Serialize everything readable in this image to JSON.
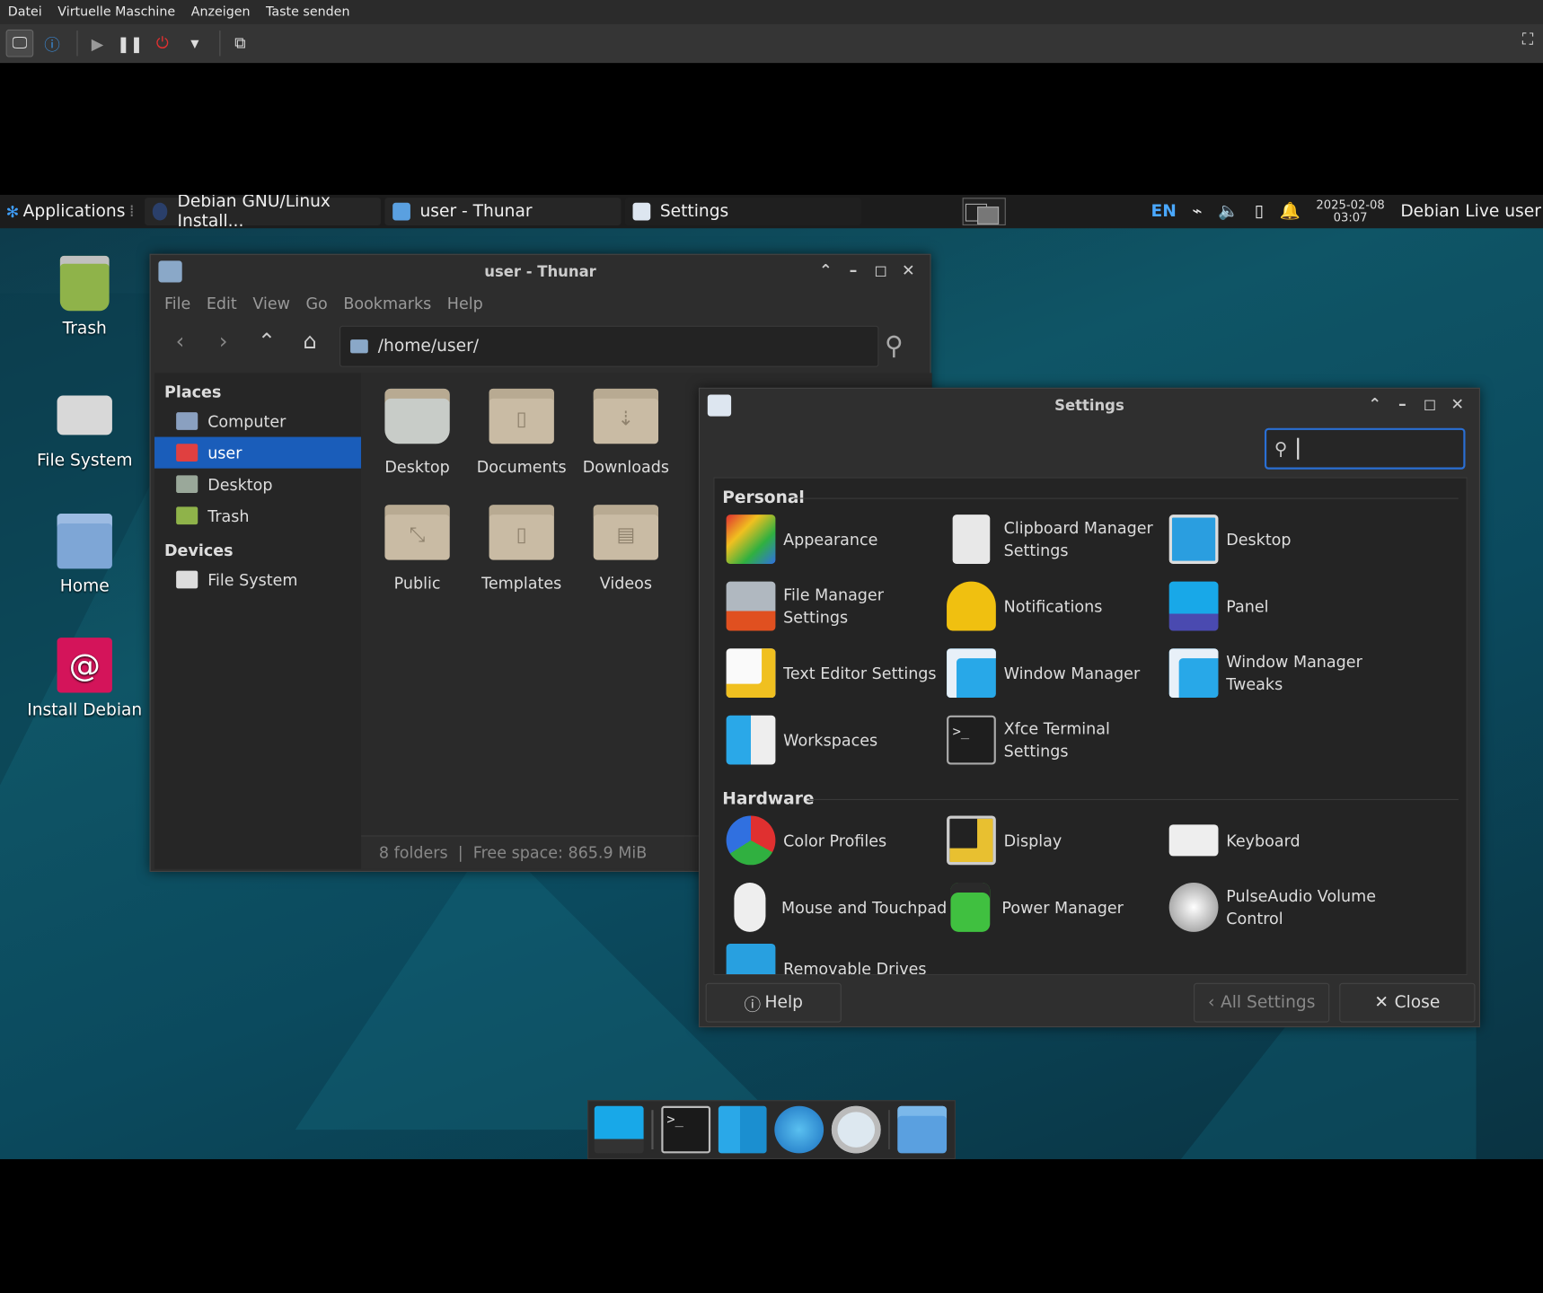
{
  "host": {
    "menu": [
      "Datei",
      "Virtuelle Maschine",
      "Anzeigen",
      "Taste senden"
    ]
  },
  "panel": {
    "applications": "Applications",
    "tasks": [
      {
        "label": "Debian GNU/Linux Install..."
      },
      {
        "label": "user - Thunar"
      },
      {
        "label": "Settings"
      }
    ],
    "keyboard_layout": "EN",
    "clock_date": "2025-02-08",
    "clock_time": "03:07",
    "user": "Debian Live user"
  },
  "desktop": {
    "icons": [
      {
        "label": "Trash"
      },
      {
        "label": "File System"
      },
      {
        "label": "Home"
      },
      {
        "label": "Install Debian"
      }
    ]
  },
  "thunar": {
    "title": "user - Thunar",
    "menu": [
      "File",
      "Edit",
      "View",
      "Go",
      "Bookmarks",
      "Help"
    ],
    "location": "/home/user/",
    "places_header": "Places",
    "places": [
      {
        "label": "Computer"
      },
      {
        "label": "user"
      },
      {
        "label": "Desktop"
      },
      {
        "label": "Trash"
      }
    ],
    "devices_header": "Devices",
    "devices": [
      {
        "label": "File System"
      }
    ],
    "folders": [
      {
        "label": "Desktop"
      },
      {
        "label": "Documents"
      },
      {
        "label": "Downloads"
      },
      {
        "label": "Public"
      },
      {
        "label": "Templates"
      },
      {
        "label": "Videos"
      }
    ],
    "status": "8 folders  |  Free space: 865.9 MiB"
  },
  "settings": {
    "title": "Settings",
    "search_value": "",
    "personal_header": "Personal",
    "personal": [
      {
        "label": "Appearance"
      },
      {
        "label": "Clipboard Manager Settings"
      },
      {
        "label": "Desktop"
      },
      {
        "label": "File Manager Settings"
      },
      {
        "label": "Notifications"
      },
      {
        "label": "Panel"
      },
      {
        "label": "Text Editor Settings"
      },
      {
        "label": "Window Manager"
      },
      {
        "label": "Window Manager Tweaks"
      },
      {
        "label": "Workspaces"
      },
      {
        "label": "Xfce Terminal Settings"
      }
    ],
    "hardware_header": "Hardware",
    "hardware": [
      {
        "label": "Color Profiles"
      },
      {
        "label": "Display"
      },
      {
        "label": "Keyboard"
      },
      {
        "label": "Mouse and Touchpad"
      },
      {
        "label": "Power Manager"
      },
      {
        "label": "PulseAudio Volume Control"
      },
      {
        "label": "Removable Drives"
      }
    ],
    "help_label": "Help",
    "all_settings_label": "All Settings",
    "close_label": "Close"
  },
  "colors": {
    "accent": "#1a5dba",
    "search_border": "#2a6fd4",
    "panel_bg": "#1c1c1c"
  }
}
